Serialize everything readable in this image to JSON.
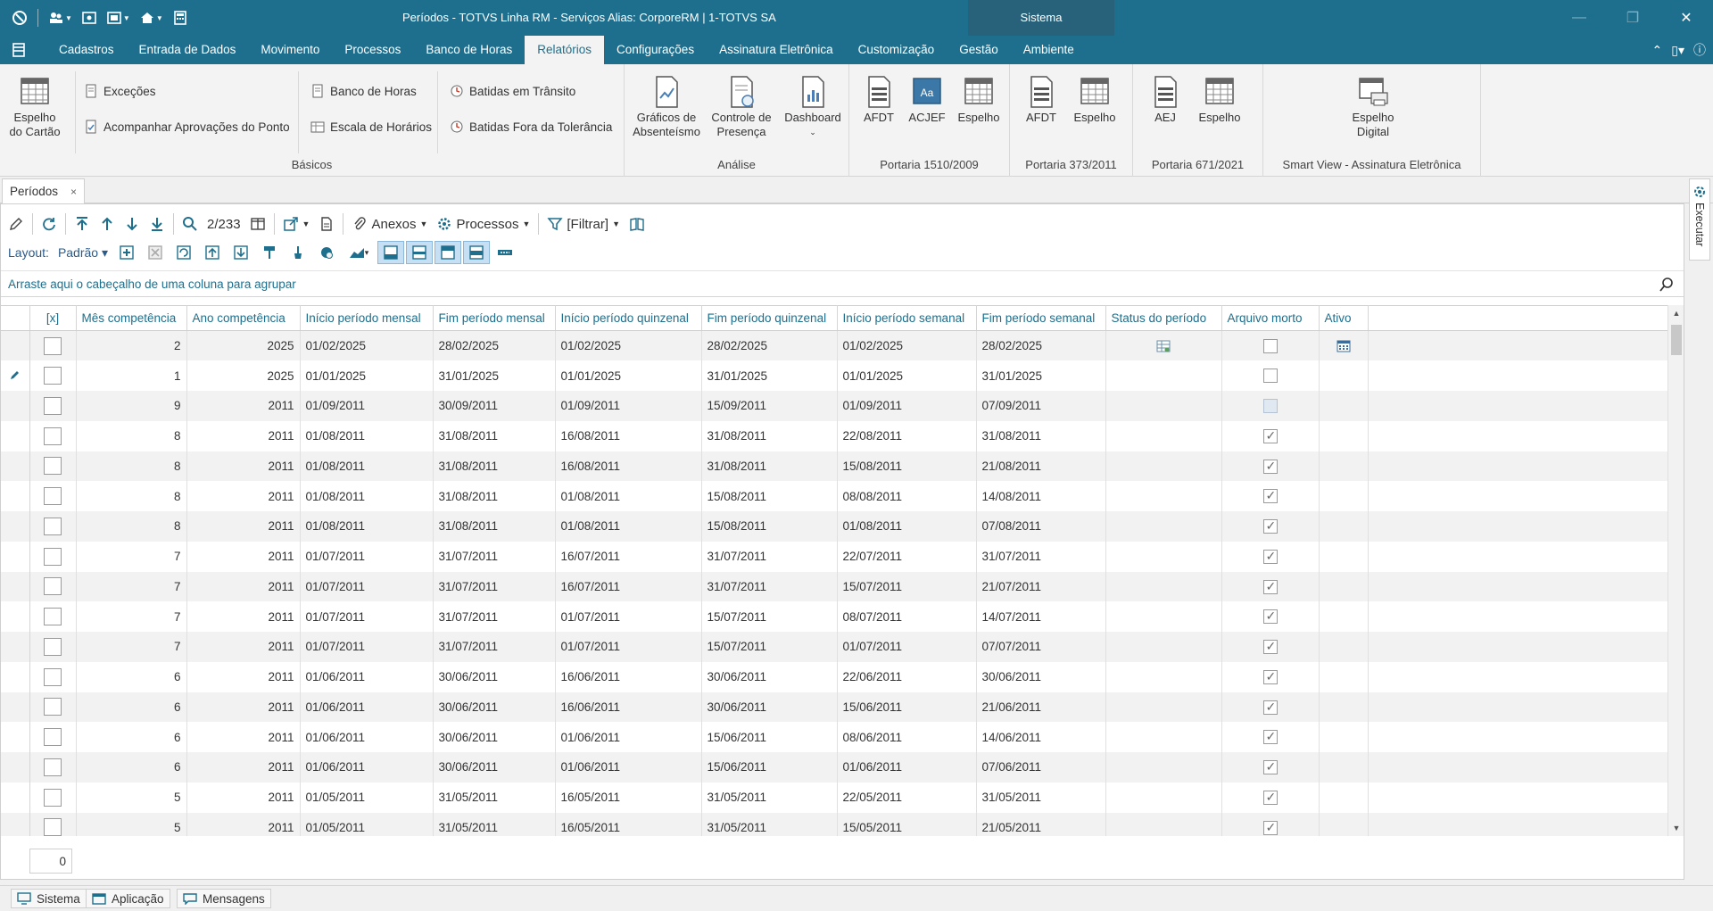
{
  "window": {
    "title": "Períodos - TOTVS Linha RM - Serviços  Alias: CorporeRM | 1-TOTVS SA",
    "context_tab": "Sistema"
  },
  "menu": {
    "items": [
      {
        "label": "Cadastros"
      },
      {
        "label": "Entrada de Dados"
      },
      {
        "label": "Movimento"
      },
      {
        "label": "Processos"
      },
      {
        "label": "Banco de Horas"
      },
      {
        "label": "Relatórios"
      },
      {
        "label": "Configurações"
      },
      {
        "label": "Assinatura Eletrônica"
      },
      {
        "label": "Customização"
      },
      {
        "label": "Gestão"
      },
      {
        "label": "Ambiente"
      }
    ],
    "active": "Relatórios"
  },
  "ribbon": {
    "basicos": {
      "label": "Básicos",
      "espelho_cartao": "Espelho\ndo Cartão",
      "excecoes": "Exceções",
      "acompanhar": "Acompanhar Aprovações do Ponto",
      "banco_horas": "Banco de Horas",
      "escala": "Escala de Horários",
      "batidas_transito": "Batidas em Trânsito",
      "batidas_fora": "Batidas Fora da Tolerância"
    },
    "analise": {
      "label": "Análise",
      "graficos": "Gráficos de\nAbsenteísmo",
      "controle": "Controle de\nPresença",
      "dashboard": "Dashboard"
    },
    "portaria_1510": {
      "label": "Portaria 1510/2009",
      "afdt": "AFDT",
      "acjef": "ACJEF",
      "espelho": "Espelho"
    },
    "portaria_373": {
      "label": "Portaria 373/2011",
      "afdt": "AFDT",
      "espelho": "Espelho"
    },
    "portaria_671": {
      "label": "Portaria 671/2021",
      "aej": "AEJ",
      "espelho": "Espelho"
    },
    "smartview": {
      "label": "Smart View - Assinatura Eletrônica",
      "espelho_digital": "Espelho\nDigital"
    }
  },
  "doc_tab": {
    "label": "Períodos",
    "close": "×"
  },
  "right_dock": {
    "label": "Executar"
  },
  "toolbar": {
    "position": "2/233",
    "anexos": "Anexos",
    "processos": "Processos",
    "filtrar": "[Filtrar]",
    "layout_label": "Layout:",
    "layout_value": "Padrão"
  },
  "group_hint": "Arraste aqui o cabeçalho de uma coluna para agrupar",
  "grid": {
    "columns": [
      "[x]",
      "Mês competência",
      "Ano competência",
      "Início período mensal",
      "Fim período mensal",
      "Início período quinzenal",
      "Fim período quinzenal",
      "Início período semanal",
      "Fim período semanal",
      "Status do período",
      "Arquivo morto",
      "Ativo"
    ],
    "rows": [
      {
        "mes": "2",
        "ano": "2025",
        "ini_m": "01/02/2025",
        "fim_m": "28/02/2025",
        "ini_q": "01/02/2025",
        "fim_q": "28/02/2025",
        "ini_s": "01/02/2025",
        "fim_s": "28/02/2025",
        "status_icon": "table-icon",
        "arquivo": "unchecked",
        "ativo_icon": "calendar-icon",
        "edit": false
      },
      {
        "mes": "1",
        "ano": "2025",
        "ini_m": "01/01/2025",
        "fim_m": "31/01/2025",
        "ini_q": "01/01/2025",
        "fim_q": "31/01/2025",
        "ini_s": "01/01/2025",
        "fim_s": "31/01/2025",
        "status_icon": "",
        "arquivo": "unchecked",
        "ativo_icon": "",
        "edit": true
      },
      {
        "mes": "9",
        "ano": "2011",
        "ini_m": "01/09/2011",
        "fim_m": "30/09/2011",
        "ini_q": "01/09/2011",
        "fim_q": "15/09/2011",
        "ini_s": "01/09/2011",
        "fim_s": "07/09/2011",
        "status_icon": "",
        "arquivo": "indeterminate",
        "ativo_icon": "",
        "edit": false
      },
      {
        "mes": "8",
        "ano": "2011",
        "ini_m": "01/08/2011",
        "fim_m": "31/08/2011",
        "ini_q": "16/08/2011",
        "fim_q": "31/08/2011",
        "ini_s": "22/08/2011",
        "fim_s": "31/08/2011",
        "status_icon": "",
        "arquivo": "checked",
        "ativo_icon": "",
        "edit": false
      },
      {
        "mes": "8",
        "ano": "2011",
        "ini_m": "01/08/2011",
        "fim_m": "31/08/2011",
        "ini_q": "16/08/2011",
        "fim_q": "31/08/2011",
        "ini_s": "15/08/2011",
        "fim_s": "21/08/2011",
        "status_icon": "",
        "arquivo": "checked",
        "ativo_icon": "",
        "edit": false
      },
      {
        "mes": "8",
        "ano": "2011",
        "ini_m": "01/08/2011",
        "fim_m": "31/08/2011",
        "ini_q": "01/08/2011",
        "fim_q": "15/08/2011",
        "ini_s": "08/08/2011",
        "fim_s": "14/08/2011",
        "status_icon": "",
        "arquivo": "checked",
        "ativo_icon": "",
        "edit": false
      },
      {
        "mes": "8",
        "ano": "2011",
        "ini_m": "01/08/2011",
        "fim_m": "31/08/2011",
        "ini_q": "01/08/2011",
        "fim_q": "15/08/2011",
        "ini_s": "01/08/2011",
        "fim_s": "07/08/2011",
        "status_icon": "",
        "arquivo": "checked",
        "ativo_icon": "",
        "edit": false
      },
      {
        "mes": "7",
        "ano": "2011",
        "ini_m": "01/07/2011",
        "fim_m": "31/07/2011",
        "ini_q": "16/07/2011",
        "fim_q": "31/07/2011",
        "ini_s": "22/07/2011",
        "fim_s": "31/07/2011",
        "status_icon": "",
        "arquivo": "checked",
        "ativo_icon": "",
        "edit": false
      },
      {
        "mes": "7",
        "ano": "2011",
        "ini_m": "01/07/2011",
        "fim_m": "31/07/2011",
        "ini_q": "16/07/2011",
        "fim_q": "31/07/2011",
        "ini_s": "15/07/2011",
        "fim_s": "21/07/2011",
        "status_icon": "",
        "arquivo": "checked",
        "ativo_icon": "",
        "edit": false
      },
      {
        "mes": "7",
        "ano": "2011",
        "ini_m": "01/07/2011",
        "fim_m": "31/07/2011",
        "ini_q": "01/07/2011",
        "fim_q": "15/07/2011",
        "ini_s": "08/07/2011",
        "fim_s": "14/07/2011",
        "status_icon": "",
        "arquivo": "checked",
        "ativo_icon": "",
        "edit": false
      },
      {
        "mes": "7",
        "ano": "2011",
        "ini_m": "01/07/2011",
        "fim_m": "31/07/2011",
        "ini_q": "01/07/2011",
        "fim_q": "15/07/2011",
        "ini_s": "01/07/2011",
        "fim_s": "07/07/2011",
        "status_icon": "",
        "arquivo": "checked",
        "ativo_icon": "",
        "edit": false
      },
      {
        "mes": "6",
        "ano": "2011",
        "ini_m": "01/06/2011",
        "fim_m": "30/06/2011",
        "ini_q": "16/06/2011",
        "fim_q": "30/06/2011",
        "ini_s": "22/06/2011",
        "fim_s": "30/06/2011",
        "status_icon": "",
        "arquivo": "checked",
        "ativo_icon": "",
        "edit": false
      },
      {
        "mes": "6",
        "ano": "2011",
        "ini_m": "01/06/2011",
        "fim_m": "30/06/2011",
        "ini_q": "16/06/2011",
        "fim_q": "30/06/2011",
        "ini_s": "15/06/2011",
        "fim_s": "21/06/2011",
        "status_icon": "",
        "arquivo": "checked",
        "ativo_icon": "",
        "edit": false
      },
      {
        "mes": "6",
        "ano": "2011",
        "ini_m": "01/06/2011",
        "fim_m": "30/06/2011",
        "ini_q": "01/06/2011",
        "fim_q": "15/06/2011",
        "ini_s": "08/06/2011",
        "fim_s": "14/06/2011",
        "status_icon": "",
        "arquivo": "checked",
        "ativo_icon": "",
        "edit": false
      },
      {
        "mes": "6",
        "ano": "2011",
        "ini_m": "01/06/2011",
        "fim_m": "30/06/2011",
        "ini_q": "01/06/2011",
        "fim_q": "15/06/2011",
        "ini_s": "01/06/2011",
        "fim_s": "07/06/2011",
        "status_icon": "",
        "arquivo": "checked",
        "ativo_icon": "",
        "edit": false
      },
      {
        "mes": "5",
        "ano": "2011",
        "ini_m": "01/05/2011",
        "fim_m": "31/05/2011",
        "ini_q": "16/05/2011",
        "fim_q": "31/05/2011",
        "ini_s": "22/05/2011",
        "fim_s": "31/05/2011",
        "status_icon": "",
        "arquivo": "checked",
        "ativo_icon": "",
        "edit": false
      },
      {
        "mes": "5",
        "ano": "2011",
        "ini_m": "01/05/2011",
        "fim_m": "31/05/2011",
        "ini_q": "16/05/2011",
        "fim_q": "31/05/2011",
        "ini_s": "15/05/2011",
        "fim_s": "21/05/2011",
        "status_icon": "",
        "arquivo": "checked",
        "ativo_icon": "",
        "edit": false
      }
    ]
  },
  "footer": {
    "count": "0"
  },
  "statusbar": {
    "sistema": "Sistema",
    "aplicacao": "Aplicação",
    "mensagens": "Mensagens"
  },
  "colors": {
    "titlebar": "#1e6f8d",
    "accent_text": "#1e6f8d",
    "row_alt": "#f2f2f2"
  }
}
